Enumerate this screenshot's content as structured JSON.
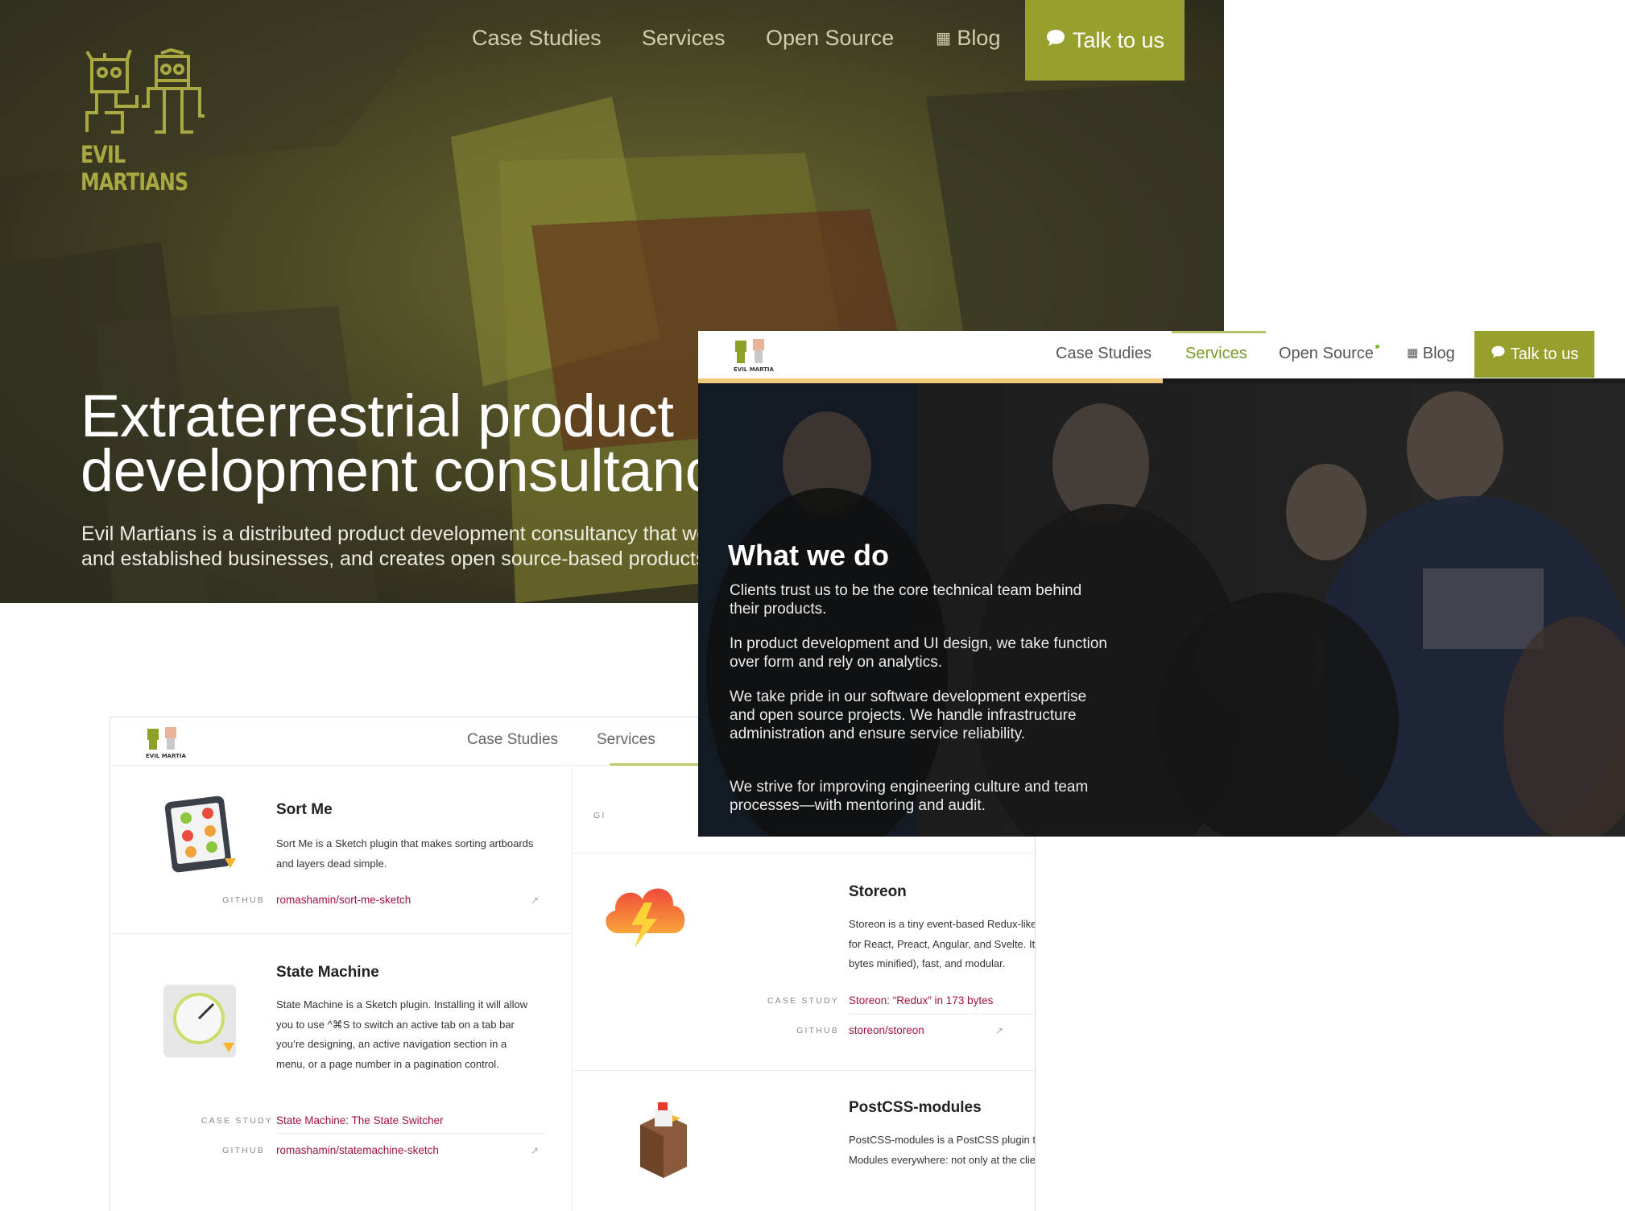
{
  "brand": {
    "name": "EVIL MARTIANS",
    "accent_color": "#97a02c",
    "link_color": "#a3123f"
  },
  "hero": {
    "nav": {
      "case_studies": "Case Studies",
      "services": "Services",
      "open_source": "Open Source",
      "blog": "Blog",
      "cta": "Talk to us"
    },
    "title_line1": "Extraterrestrial product",
    "title_line2": "development consultancy",
    "subtitle_line1": "Evil Martians is a distributed product development consultancy that works with startups",
    "subtitle_line2": "and established businesses, and creates open source-based products"
  },
  "what_we_do": {
    "nav": {
      "case_studies": "Case Studies",
      "services": "Services",
      "open_source": "Open Source",
      "blog": "Blog",
      "cta": "Talk to us"
    },
    "title": "What we do",
    "p1": "Clients trust us to be the core technical team behind their products.",
    "p2": "In product development and UI design, we take function over form and rely on analytics.",
    "p3": "We take pride in our software development expertise and open source projects. We handle infrastructure administration and ensure service reliability.",
    "p4": "We strive for improving engineering culture and team processes—with mentoring and audit."
  },
  "open_source": {
    "nav": {
      "case_studies": "Case Studies",
      "services": "Services"
    },
    "label_case_study": "CASE STUDY",
    "label_github": "GITHUB",
    "cards": [
      {
        "title": "Sort Me",
        "desc": "Sort Me is a Sketch plugin that makes sorting artboards and layers dead simple.",
        "github": "romashamin/sort-me-sketch"
      },
      {
        "title": "State Machine",
        "desc": "State Machine is a Sketch plugin. Installing it will allow you to use ^⌘S to switch an active tab on a tab bar you’re designing, an active navigation section in a menu, or a page number in a pagination control.",
        "case_study": "State Machine: The State Switcher",
        "github": "romashamin/statemachine-sketch"
      },
      {
        "title": "Storeon",
        "desc": "Storeon is a tiny event-based Redux-like state manager for React, Preact, Angular, and Svelte. It is small (173 bytes minified), fast, and modular.",
        "case_study": "Storeon: “Redux” in 173 bytes",
        "github": "storeon/storeon"
      },
      {
        "title": "PostCSS-modules",
        "desc": "PostCSS-modules is a PostCSS plugin to use CSS Modules everywhere: not only at the client side."
      }
    ],
    "partial_label": "GI"
  }
}
